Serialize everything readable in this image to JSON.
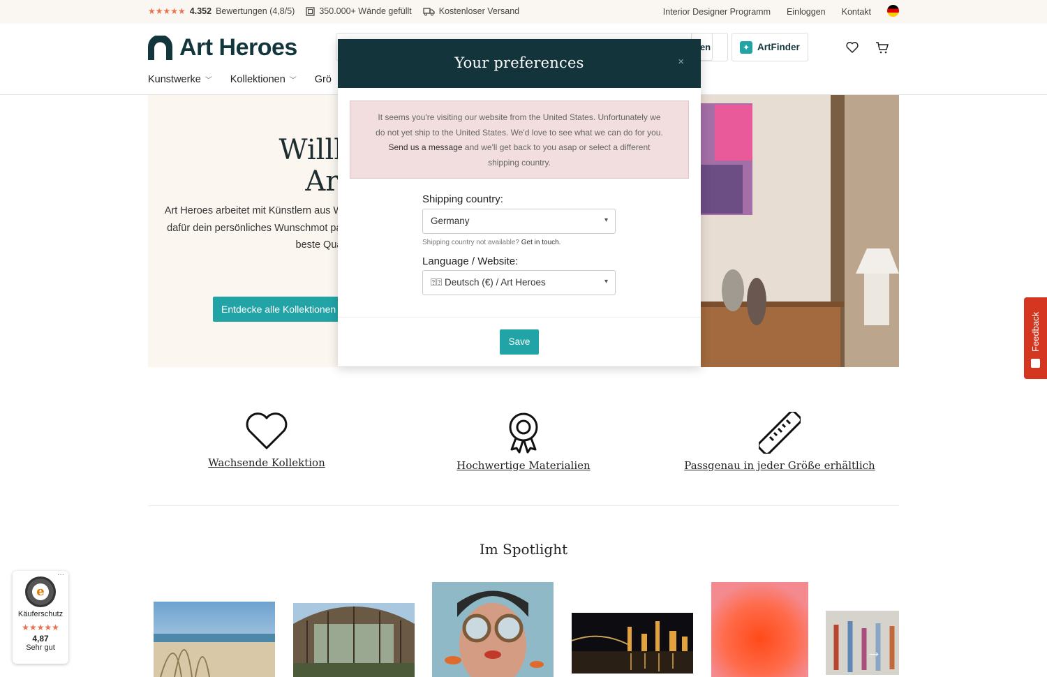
{
  "topbar": {
    "stars": "★★★★★",
    "reviews_count": "4.352",
    "reviews_label": "Bewertungen (4,8/5)",
    "walls": "350.000+ Wände gefüllt",
    "shipping": "Kostenloser Versand",
    "links": [
      "Interior Designer Programm",
      "Einloggen",
      "Kontakt"
    ]
  },
  "header": {
    "logo": "Art Heroes",
    "search_button_partial": "hen",
    "artfinder": "ArtFinder",
    "nav": [
      "Kunstwerke",
      "Kollektionen",
      "Grö"
    ]
  },
  "hero": {
    "title_line1": "Willkom",
    "title_line2": "Art He",
    "text": "Art Heroes arbeitet mit Künstlern aus Wände schöner zu machen. Gestalte d dafür dein persönliches Wunschmot passende Größe aus. Den Rest erledig beste Qualität zun",
    "button": "Entdecke alle Kollektionen"
  },
  "features": [
    {
      "label": "Wachsende Kollektion",
      "icon": "heart-icon"
    },
    {
      "label": "Hochwertige Materialien",
      "icon": "award-icon"
    },
    {
      "label": "Passgenau in jeder Größe erhältlich",
      "icon": "ruler-icon"
    }
  ],
  "spotlight": {
    "title": "Im Spotlight"
  },
  "trust_badge": {
    "label": "Käuferschutz",
    "stars": "★★★★★",
    "score": "4,87",
    "rating": "Sehr gut",
    "more": "···"
  },
  "feedback": {
    "label": "Feedback"
  },
  "modal": {
    "title": "Your preferences",
    "close": "×",
    "alert_part1": "It seems you're visiting our website from the United States. Unfortunately we do not yet ship to the United States. We'd love to see what we can do for you. ",
    "alert_link": "Send us a message",
    "alert_part2": " and we'll get back to you asap or select a different shipping country.",
    "shipping_label": "Shipping country:",
    "shipping_value": "Germany",
    "hint_text": "Shipping country not available? ",
    "hint_link": "Get in touch.",
    "language_label": "Language / Website:",
    "language_value": "⍰⍰ Deutsch (€) / Art Heroes",
    "save": "Save"
  },
  "colors": {
    "accent": "#22a4a7",
    "brand_dark": "#12343a",
    "alert_bg": "#f2dede",
    "star": "#e8734e",
    "feedback": "#d4361f"
  }
}
